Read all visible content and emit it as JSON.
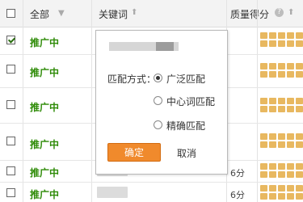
{
  "header": {
    "all_label": "全部",
    "dropdown_icon": "chevron-down-icon",
    "keyword_label": "关键词",
    "sort_icon": "sort-up-icon",
    "quality_label": "质量得分"
  },
  "rows": [
    {
      "status": "推广中",
      "checked": true
    },
    {
      "status": "推广中",
      "checked": false
    },
    {
      "status": "推广中",
      "checked": false
    },
    {
      "status": "推广中",
      "checked": false
    },
    {
      "status": "推广中",
      "checked": false,
      "score": "6分"
    },
    {
      "status": "推广中",
      "checked": false,
      "score": "6分"
    }
  ],
  "popup": {
    "match_label": "匹配方式：",
    "options": [
      "广泛匹配",
      "中心词匹配",
      "精确匹配"
    ],
    "selected_index": 0,
    "confirm_label": "确定",
    "cancel_label": "取消"
  },
  "colors": {
    "status_green": "#2e8b07",
    "confirm_orange": "#f08a2c",
    "star_gold": "#e8b860"
  }
}
